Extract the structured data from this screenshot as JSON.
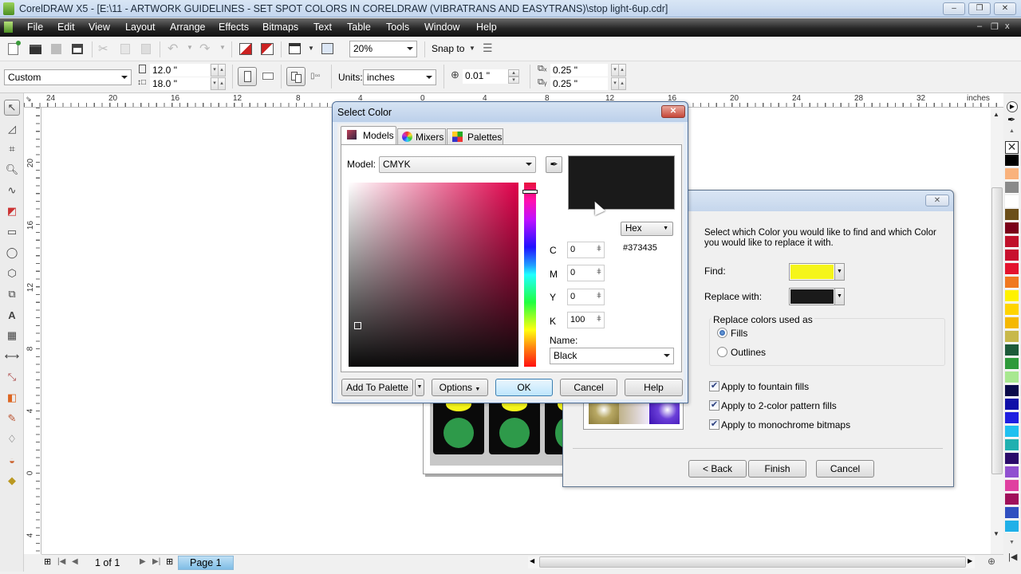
{
  "window": {
    "title": "CorelDRAW X5 - [E:\\11 - ARTWORK GUIDELINES - SET SPOT COLORS IN CORELDRAW (VIBRATRANS AND EASYTRANS)\\stop light-6up.cdr]",
    "minimize": "–",
    "restore": "❐",
    "close": "✕"
  },
  "menu": {
    "items": [
      "File",
      "Edit",
      "View",
      "Layout",
      "Arrange",
      "Effects",
      "Bitmaps",
      "Text",
      "Table",
      "Tools",
      "Window",
      "Help"
    ],
    "doc_controls": [
      "–",
      "❐",
      "x"
    ]
  },
  "standard_toolbar": {
    "zoom_level": "20%",
    "snap_to": "Snap to"
  },
  "property_bar": {
    "page_size": "Custom",
    "width": "12.0 \"",
    "height": "18.0 \"",
    "units_label": "Units:",
    "units": "inches",
    "nudge": "0.01 \"",
    "dup_x": "0.25 \"",
    "dup_y": "0.25 \""
  },
  "rulers": {
    "units": "inches",
    "horizontal_labels": [
      "24",
      "20",
      "16",
      "12",
      "8",
      "4",
      "0",
      "4",
      "8",
      "12",
      "16",
      "20",
      "24",
      "28",
      "32"
    ],
    "vertical_labels": [
      "20",
      "16",
      "12",
      "8",
      "4",
      "0",
      "4"
    ]
  },
  "page_nav": {
    "counter": "1 of 1",
    "page_tab": "Page 1"
  },
  "palette": {
    "colors": [
      "#000000",
      "#f9b27c",
      "#8a8a8a",
      "#ffffff",
      "#6b4e1a",
      "#7a0018",
      "#c0102a",
      "#c8102e",
      "#e3122d",
      "#f07820",
      "#fff200",
      "#ffd400",
      "#f5b800",
      "#c8b84a",
      "#1d5a3a",
      "#2e9a3a",
      "#a8e890",
      "#0a0a4a",
      "#1010a8",
      "#1f1fe0",
      "#20c0f0",
      "#20b0b0",
      "#2a0a6a",
      "#9050d0",
      "#e040a0",
      "#a0105a",
      "#3050c0",
      "#20b0e8"
    ]
  },
  "select_color": {
    "title": "Select Color",
    "tabs": [
      "Models",
      "Mixers",
      "Palettes"
    ],
    "model_label": "Model:",
    "model": "CMYK",
    "format": "Hex",
    "hex_value": "#373435",
    "c_label": "C",
    "c": "0",
    "m_label": "M",
    "m": "0",
    "y_label": "Y",
    "y": "0",
    "k_label": "K",
    "k": "100",
    "name_label": "Name:",
    "name": "Black",
    "preview_color": "#1a1a1a",
    "buttons": {
      "add_to_palette": "Add To Palette",
      "options": "Options",
      "ok": "OK",
      "cancel": "Cancel",
      "help": "Help"
    }
  },
  "replace_wizard": {
    "instructions": "Select which Color you would like to find and which Color you would like to replace it with.",
    "find_label": "Find:",
    "find_color": "#f5f51a",
    "replace_label": "Replace with:",
    "replace_color": "#1a1a1a",
    "group_label": "Replace colors used as",
    "options": [
      {
        "label": "Fills",
        "selected": true
      },
      {
        "label": "Outlines",
        "selected": false
      }
    ],
    "checkboxes": [
      {
        "label": "Apply to fountain fills",
        "checked": true
      },
      {
        "label": "Apply to 2-color pattern fills",
        "checked": true
      },
      {
        "label": "Apply to monochrome bitmaps",
        "checked": true
      }
    ],
    "buttons": {
      "back": "< Back",
      "finish": "Finish",
      "cancel": "Cancel"
    },
    "close": "✕"
  }
}
